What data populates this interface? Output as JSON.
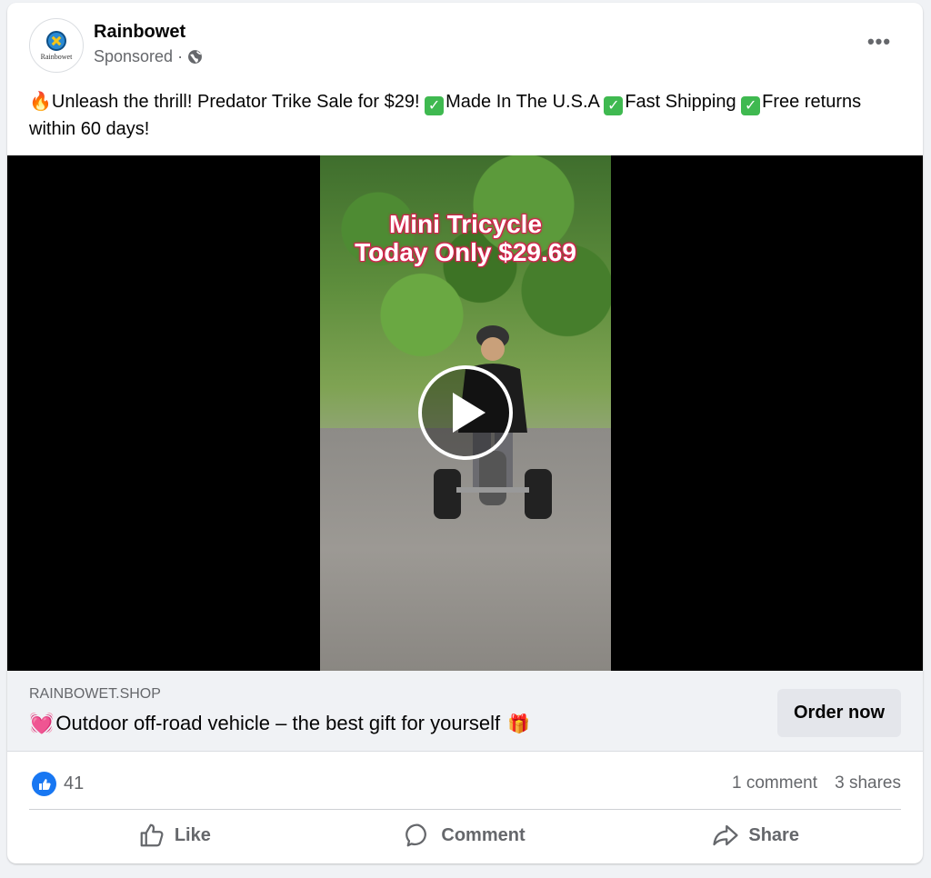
{
  "post": {
    "page_name": "Rainbowet",
    "avatar_text": "Rainbowet",
    "sponsored": "Sponsored ·",
    "more": "•••",
    "text_line_1": "Unleash the thrill! Predator Trike Sale for $29!",
    "text_check_1": "Made In The U.S.A",
    "text_check_2": "Fast Shipping",
    "text_check_3": "Free returns within 60 days!"
  },
  "media": {
    "overlay_line_1": "Mini Tricycle",
    "overlay_line_2": "Today Only $29.69"
  },
  "link": {
    "domain": "RAINBOWET.SHOP",
    "title": "Outdoor off-road vehicle – the best gift for yourself",
    "cta": "Order now"
  },
  "stats": {
    "likes": "41",
    "comments": "1 comment",
    "shares": "3 shares"
  },
  "actions": {
    "like": "Like",
    "comment": "Comment",
    "share": "Share"
  },
  "colors": {
    "accent": "#1877f2",
    "overlay_outline": "#d6204e",
    "check_green": "#3fb950"
  },
  "icons": {
    "globe": "globe-icon",
    "play": "play-icon",
    "like": "thumbs-up-icon",
    "comment": "speech-bubble-icon",
    "share": "share-arrow-icon"
  }
}
